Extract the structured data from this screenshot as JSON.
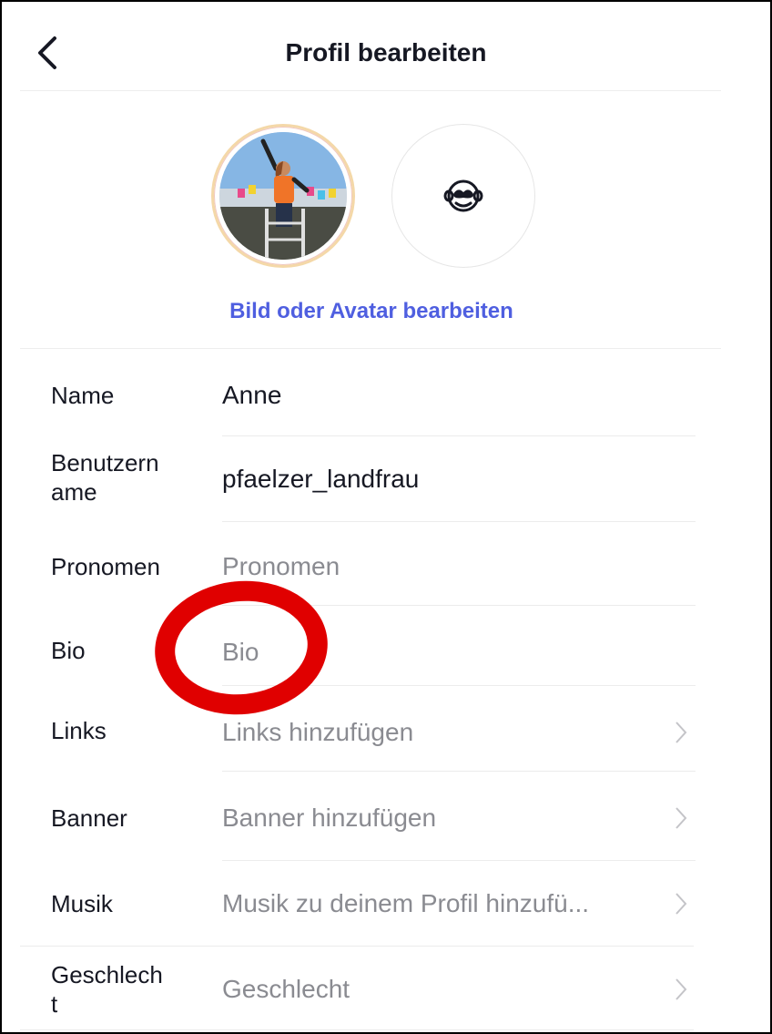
{
  "header": {
    "title": "Profil bearbeiten"
  },
  "avatar": {
    "edit_link": "Bild oder Avatar bearbeiten"
  },
  "fields": [
    {
      "label": "Name",
      "value": "Anne",
      "is_placeholder": false
    },
    {
      "label": "Benutzername",
      "label_line1": "Benutzern",
      "label_line2": "ame",
      "value": "pfaelzer_landfrau",
      "is_placeholder": false
    },
    {
      "label": "Pronomen",
      "value": "Pronomen",
      "is_placeholder": true
    },
    {
      "label": "Bio",
      "value": "Bio",
      "is_placeholder": true
    },
    {
      "label": "Links",
      "value": "Links hinzufügen",
      "is_placeholder": true
    },
    {
      "label": "Banner",
      "value": "Banner hinzufügen",
      "is_placeholder": true
    },
    {
      "label": "Musik",
      "value": "Musik zu deinem Profil hinzufü...",
      "is_placeholder": true
    },
    {
      "label": "Geschlecht",
      "label_line1": "Geschlech",
      "label_line2": "t",
      "value": "Geschlecht",
      "is_placeholder": true
    }
  ],
  "colors": {
    "accent": "#4f5fe0",
    "annotation": "#e00000",
    "placeholder": "#8a8b91",
    "text": "#161823"
  },
  "icons": {
    "back": "chevron-left-icon",
    "avatar_alt": "monkey-face-icon",
    "row_chevron": "chevron-right-icon"
  }
}
